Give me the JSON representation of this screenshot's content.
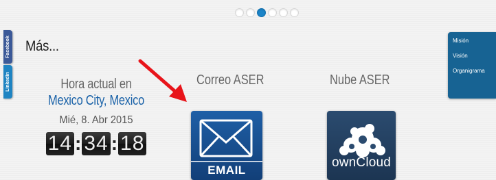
{
  "carousel": {
    "dot_count": 6,
    "active_index": 2
  },
  "social": {
    "facebook_label": "Facebook",
    "linkedin_label": "LinkedIn"
  },
  "section_title": "Más...",
  "clock": {
    "heading": "Hora actual en",
    "city": "Mexico City, Mexico",
    "date": "Mié, 8. Abr 2015",
    "hours": "14",
    "minutes": "34",
    "seconds": "18",
    "separator": ":"
  },
  "apps": {
    "email": {
      "title": "Correo ASER",
      "icon_label": "EMAIL",
      "icon": "envelope-icon"
    },
    "cloud": {
      "title": "Nube ASER",
      "icon_label": "ownCloud",
      "icon": "owncloud-icon"
    }
  },
  "right_menu": {
    "items": [
      "Misión",
      "Visión",
      "Organigrama"
    ]
  },
  "colors": {
    "accent": "#1b84c8",
    "menu_bg": "#176393",
    "email_bg": "#1f5fa6",
    "cloud_bg": "#2b4b6f",
    "arrow": "#e8141a"
  }
}
